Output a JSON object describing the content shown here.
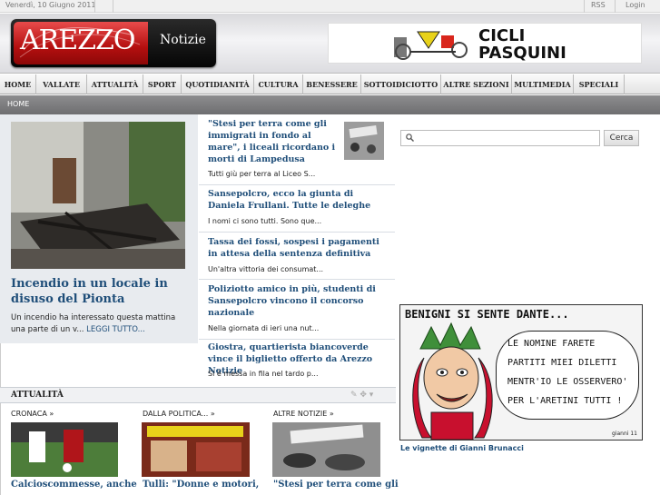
{
  "topbar": {
    "date": "Venerdì, 10 Giugno 2011",
    "rss": "RSS",
    "login": "Login"
  },
  "header": {
    "logo_word": "AREZZO",
    "logo_sub": "Notizie",
    "ad_line1": "CICLI",
    "ad_line2": "PASQUINI"
  },
  "nav": {
    "items": [
      "HOME",
      "VALLATE",
      "ATTUALITÀ",
      "SPORT",
      "QUOTIDIANITÀ",
      "CULTURA",
      "BENESSERE",
      "SOTTOIDICIOTTO",
      "ALTRE SEZIONI",
      "MULTIMEDIA",
      "SPECIALI"
    ]
  },
  "breadcrumb": {
    "home": "HOME"
  },
  "featured": {
    "title": "Incendio in un locale in disuso del Pionta",
    "desc": "Un incendio ha interessato questa mattina una parte di un v...",
    "more": "LEGGI TUTTO..."
  },
  "stories": [
    {
      "title": "\"Stesi per terra come gli immigrati in fondo al mare\", i liceali ricordano i morti di Lampedusa",
      "desc": "Tutti giù per terra al Liceo S..."
    },
    {
      "title": "Sansepolcro, ecco la giunta di Daniela Frullani. Tutte le deleghe",
      "desc": "I nomi ci sono tutti. Sono que..."
    },
    {
      "title": "Tassa dei fossi, sospesi i pagamenti in attesa della sentenza definitiva",
      "desc": "Un'altra vittoria dei consumat..."
    },
    {
      "title": "Poliziotto amico in più, studenti di Sansepolcro vincono il concorso nazionale",
      "desc": "Nella giornata di ieri una nut..."
    },
    {
      "title": "Giostra, quartierista biancoverde vince il biglietto offerto da Arezzo Notizie",
      "desc": "Si è messa in fila nel tardo p..."
    }
  ],
  "search": {
    "placeholder": "",
    "button": "Cerca"
  },
  "cartoon": {
    "title": "BENIGNI SI SENTE DANTE...",
    "lines": [
      "LE NOMINE FARETE",
      "PARTITI MIEI DILETTI",
      "MENTR'IO LE OSSERVERO'",
      "PER L'ARETINI TUTTI !"
    ],
    "signature": "gianni 11",
    "caption": "Le vignette di Gianni Brunacci"
  },
  "section": {
    "title": "ATTUALITÀ",
    "columns": [
      {
        "label": "CRONACA »",
        "title": "Calcioscommesse, anche"
      },
      {
        "label": "DALLA POLITICA... »",
        "title": "Tulli: \"Donne e motori,"
      },
      {
        "label": "ALTRE NOTIZIE »",
        "title": "\"Stesi per terra come gli"
      }
    ]
  },
  "colors": {
    "link": "#1f4e79",
    "brand_red": "#c8102e",
    "nav_bg": "#eeeeee"
  }
}
